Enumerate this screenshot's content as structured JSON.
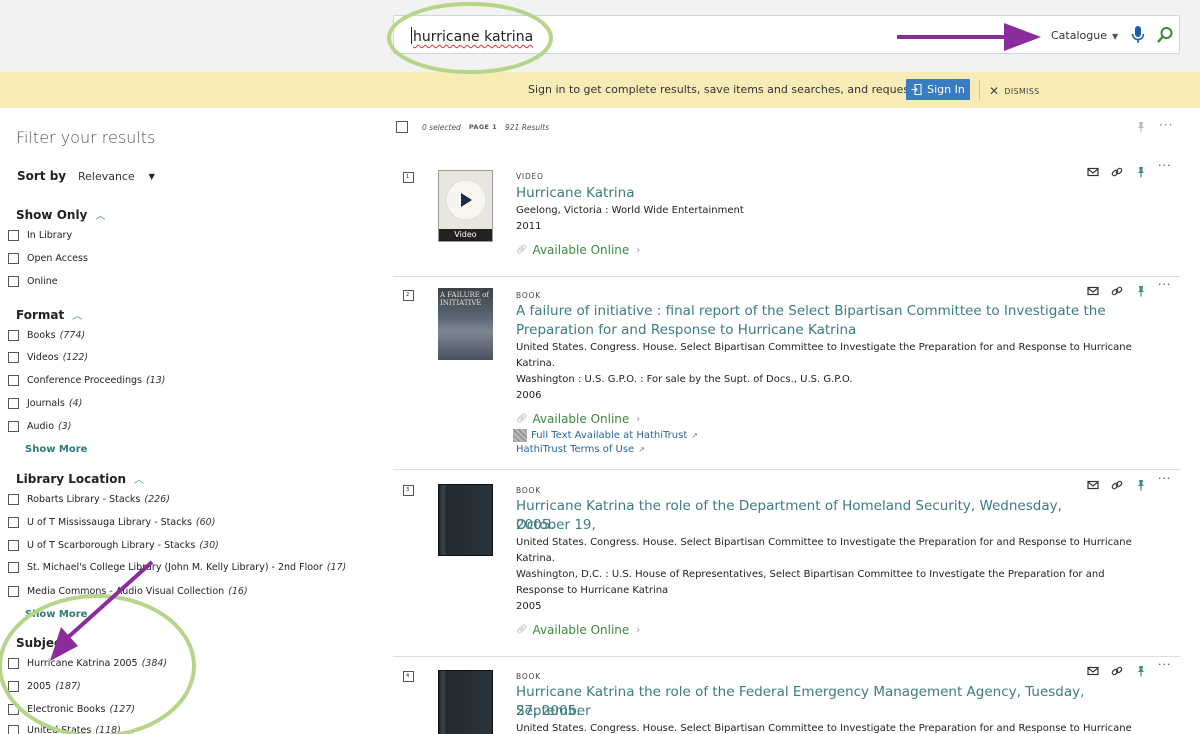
{
  "search": {
    "query": "hurricane katrina",
    "scope": "Catalogue"
  },
  "banner": {
    "message": "Sign in to get complete results, save items and searches, and request items",
    "sign_in": "Sign In",
    "dismiss": "DISMISS"
  },
  "filters": {
    "title": "Filter your results",
    "sort_label": "Sort by",
    "sort_value": "Relevance",
    "show_only": {
      "heading": "Show Only",
      "items": [
        {
          "label": "In Library"
        },
        {
          "label": "Open Access"
        },
        {
          "label": "Online"
        }
      ]
    },
    "format": {
      "heading": "Format",
      "items": [
        {
          "label": "Books",
          "count": "(774)"
        },
        {
          "label": "Videos",
          "count": "(122)"
        },
        {
          "label": "Conference Proceedings",
          "count": "(13)"
        },
        {
          "label": "Journals",
          "count": "(4)"
        },
        {
          "label": "Audio",
          "count": "(3)"
        }
      ],
      "show_more": "Show More"
    },
    "location": {
      "heading": "Library Location",
      "items": [
        {
          "label": "Robarts Library - Stacks",
          "count": "(226)"
        },
        {
          "label": "U of T Mississauga Library - Stacks",
          "count": "(60)"
        },
        {
          "label": "U of T Scarborough Library - Stacks",
          "count": "(30)"
        },
        {
          "label": "St. Michael's College Library (John M. Kelly Library) - 2nd Floor",
          "count": "(17)"
        },
        {
          "label": "Media Commons - Audio Visual Collection",
          "count": "(16)"
        }
      ],
      "show_more": "Show More"
    },
    "subject": {
      "heading": "Subject",
      "items": [
        {
          "label": "Hurricane Katrina 2005",
          "count": "(384)"
        },
        {
          "label": "2005",
          "count": "(187)"
        },
        {
          "label": "Electronic Books",
          "count": "(127)"
        },
        {
          "label": "United States",
          "count": "(118)"
        }
      ]
    }
  },
  "results_header": {
    "selected": "0 selected",
    "page": "PAGE 1",
    "count": "921 Results"
  },
  "results": [
    {
      "index": "1",
      "type": "VIDEO",
      "thumb_label": "Video",
      "title_lines": [
        "Hurricane Katrina"
      ],
      "lines": [
        "Geelong, Victoria : World Wide Entertainment",
        "2011"
      ],
      "availability": "Available Online"
    },
    {
      "index": "2",
      "type": "BOOK",
      "thumb_label": "A FAILURE of INITIATIVE",
      "title_lines": [
        "A failure of initiative : final report of the Select Bipartisan Committee to Investigate the",
        "Preparation for and Response to Hurricane Katrina"
      ],
      "lines": [
        "United States. Congress. House. Select Bipartisan Committee to Investigate the Preparation for and Response to Hurricane",
        "Katrina.",
        "Washington : U.S. G.P.O. : For sale by the Supt. of Docs., U.S. G.P.O.",
        "2006"
      ],
      "availability": "Available Online",
      "full_text": "Full Text Available at HathiTrust",
      "terms": "HathiTrust Terms of Use"
    },
    {
      "index": "3",
      "type": "BOOK",
      "title_lines": [
        "Hurricane Katrina the role of the Department of Homeland Security, Wednesday, October 19,",
        "2005."
      ],
      "lines": [
        "United States. Congress. House. Select Bipartisan Committee to Investigate the Preparation for and Response to Hurricane",
        "Katrina.",
        "Washington, D.C. : U.S. House of Representatives, Select Bipartisan Committee to Investigate the Preparation for and",
        "Response to Hurricane Katrina",
        "2005"
      ],
      "availability": "Available Online"
    },
    {
      "index": "4",
      "type": "BOOK",
      "title_lines": [
        "Hurricane Katrina the role of the Federal Emergency Management Agency, Tuesday, September",
        "27, 2005."
      ],
      "lines": [
        "United States. Congress. House. Select Bipartisan Committee to Investigate the Preparation for and Response to Hurricane"
      ]
    }
  ],
  "colors": {
    "accent": "#3c7c80",
    "available": "#3d8a3d",
    "banner": "#f7ecb5",
    "annotation_circle": "#b5d68a",
    "annotation_arrow": "#8a2c9c"
  }
}
